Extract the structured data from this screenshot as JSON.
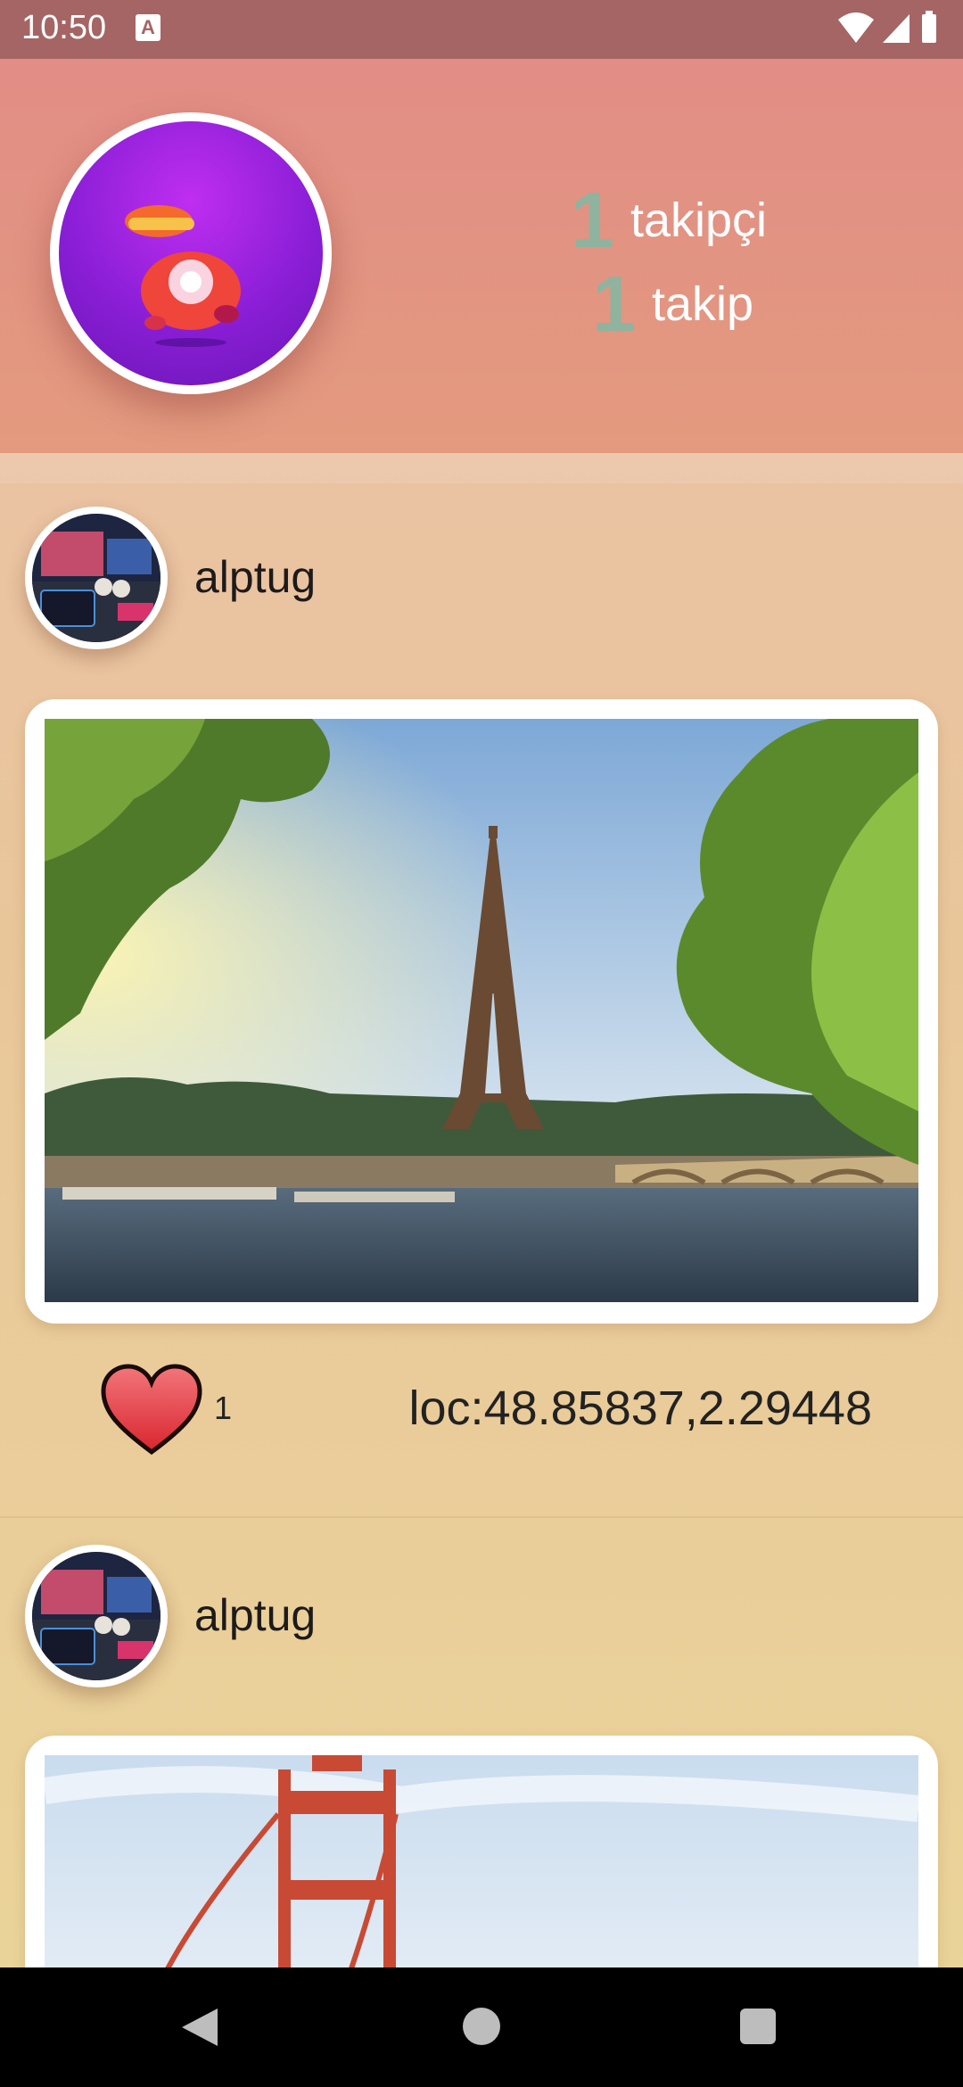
{
  "status_bar": {
    "time": "10:50",
    "notification_icon": "A"
  },
  "header": {
    "followers_count": "1",
    "followers_label": "takipçi",
    "following_count": "1",
    "following_label": "takip"
  },
  "posts": [
    {
      "author": "alptug",
      "likes": "1",
      "location": "loc:48.85837,2.29448",
      "image": "eiffel-tower-photo"
    },
    {
      "author": "alptug",
      "image": "golden-gate-bridge-photo"
    }
  ],
  "icons": {
    "like": "heart-icon",
    "back": "back-icon",
    "home": "home-icon",
    "recents": "recents-icon"
  },
  "colors": {
    "status_bar": "#a56565",
    "header": "#e28d86",
    "count_accent": "#8fb39e",
    "heart": "#e0363a"
  }
}
